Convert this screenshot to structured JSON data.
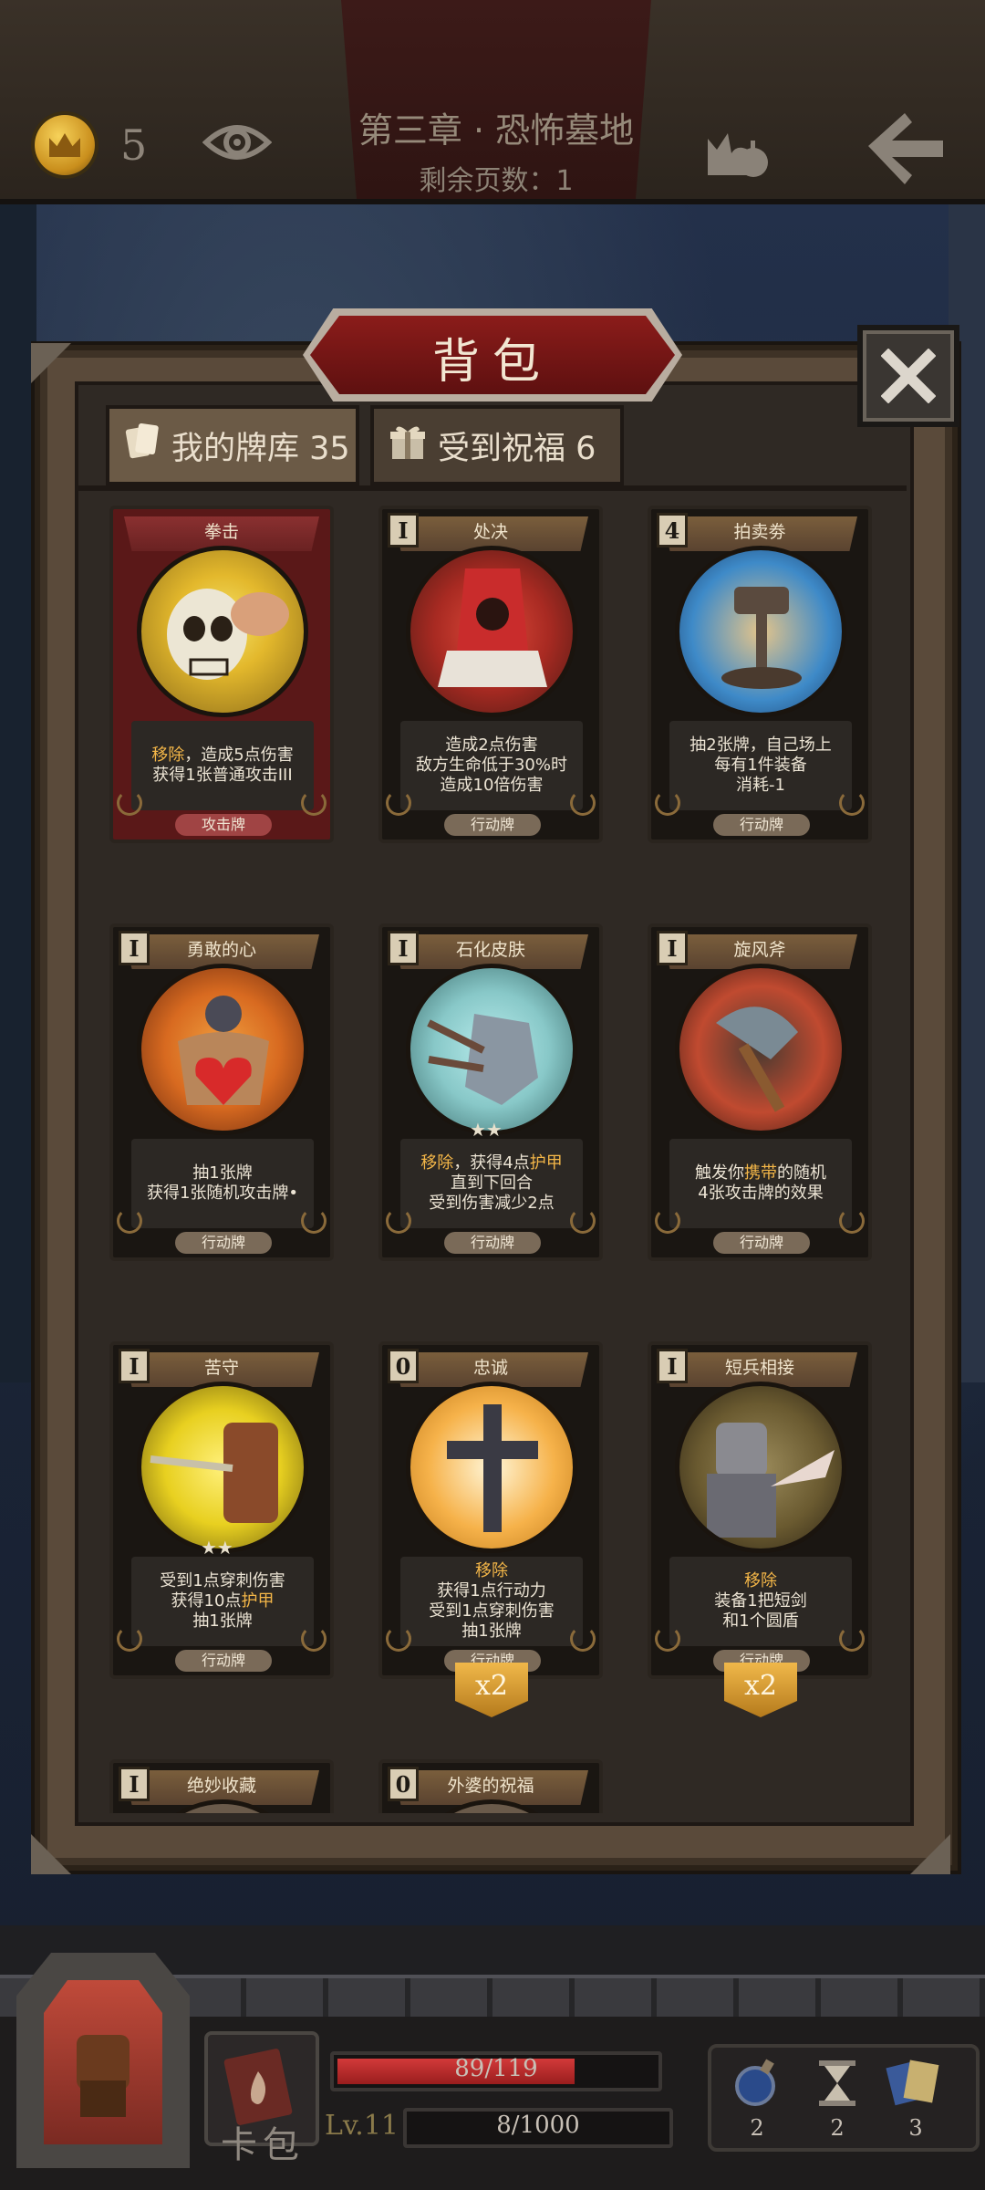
{
  "topbar": {
    "coins": "5",
    "chapter_title": "第三章 · 恐怖墓地",
    "pages_remaining": "剩余页数：1"
  },
  "panel": {
    "title": "背包",
    "tabs": [
      {
        "label": "我的牌库 35",
        "active": true,
        "icon": "cards-icon"
      },
      {
        "label": "受到祝福 6",
        "active": false,
        "icon": "gift-icon"
      }
    ]
  },
  "cards": [
    {
      "name": "拳击",
      "cost": "",
      "style": "red",
      "desc": [
        "移除，造成5点伤害",
        "获得1张普通攻击III"
      ],
      "keyword_line": 0,
      "type": "攻击牌"
    },
    {
      "name": "处决",
      "cost": "I",
      "desc": [
        "造成2点伤害",
        "敌方生命低于30%时",
        "造成10倍伤害"
      ],
      "type": "行动牌"
    },
    {
      "name": "拍卖劵",
      "cost": "4",
      "desc": [
        "抽2张牌，自己场上",
        "每有1件装备",
        "消耗-1"
      ],
      "type": "行动牌"
    },
    {
      "name": "勇敢的心",
      "cost": "I",
      "desc": [
        "抽1张牌",
        "获得1张随机攻击牌•"
      ],
      "type": "行动牌"
    },
    {
      "name": "石化皮肤",
      "cost": "I",
      "desc": [
        "移除，获得4点护甲",
        "直到下回合",
        "受到伤害减少2点"
      ],
      "keyword_line": 0,
      "stars": "★★",
      "type": "行动牌"
    },
    {
      "name": "旋风斧",
      "cost": "I",
      "desc": [
        "触发你携带的随机",
        "4张攻击牌的效果"
      ],
      "type": "行动牌"
    },
    {
      "name": "苦守",
      "cost": "I",
      "desc": [
        "受到1点穿刺伤害",
        "获得10点护甲",
        "抽1张牌"
      ],
      "stars": "★★",
      "type": "行动牌"
    },
    {
      "name": "忠诚",
      "cost": "0",
      "desc": [
        "移除",
        "获得1点行动力",
        "受到1点穿刺伤害",
        "抽1张牌"
      ],
      "keyword_line": 0,
      "type": "行动牌",
      "multiplier": "x2"
    },
    {
      "name": "短兵相接",
      "cost": "I",
      "desc": [
        "移除",
        "装备1把短剑",
        "和1个圆盾"
      ],
      "keyword_line": 0,
      "type": "行动牌",
      "multiplier": "x2"
    },
    {
      "name": "绝妙收藏",
      "cost": "I",
      "desc": [],
      "type": ""
    },
    {
      "name": "外婆的祝福",
      "cost": "0",
      "desc": [],
      "type": ""
    }
  ],
  "bottom": {
    "deck_label": "卡包",
    "hp_text": "89/119",
    "hp_fraction": 0.748,
    "level": "Lv.11",
    "xp_text": "8/1000",
    "inventory": [
      {
        "icon": "potion-icon",
        "count": "2"
      },
      {
        "icon": "hourglass-icon",
        "count": "2"
      },
      {
        "icon": "card-stack-icon",
        "count": "3"
      }
    ]
  },
  "colors": {
    "keyword": "#f3b648",
    "banner_red": "#8b1c1a",
    "hp_red": "#d23a3a"
  }
}
